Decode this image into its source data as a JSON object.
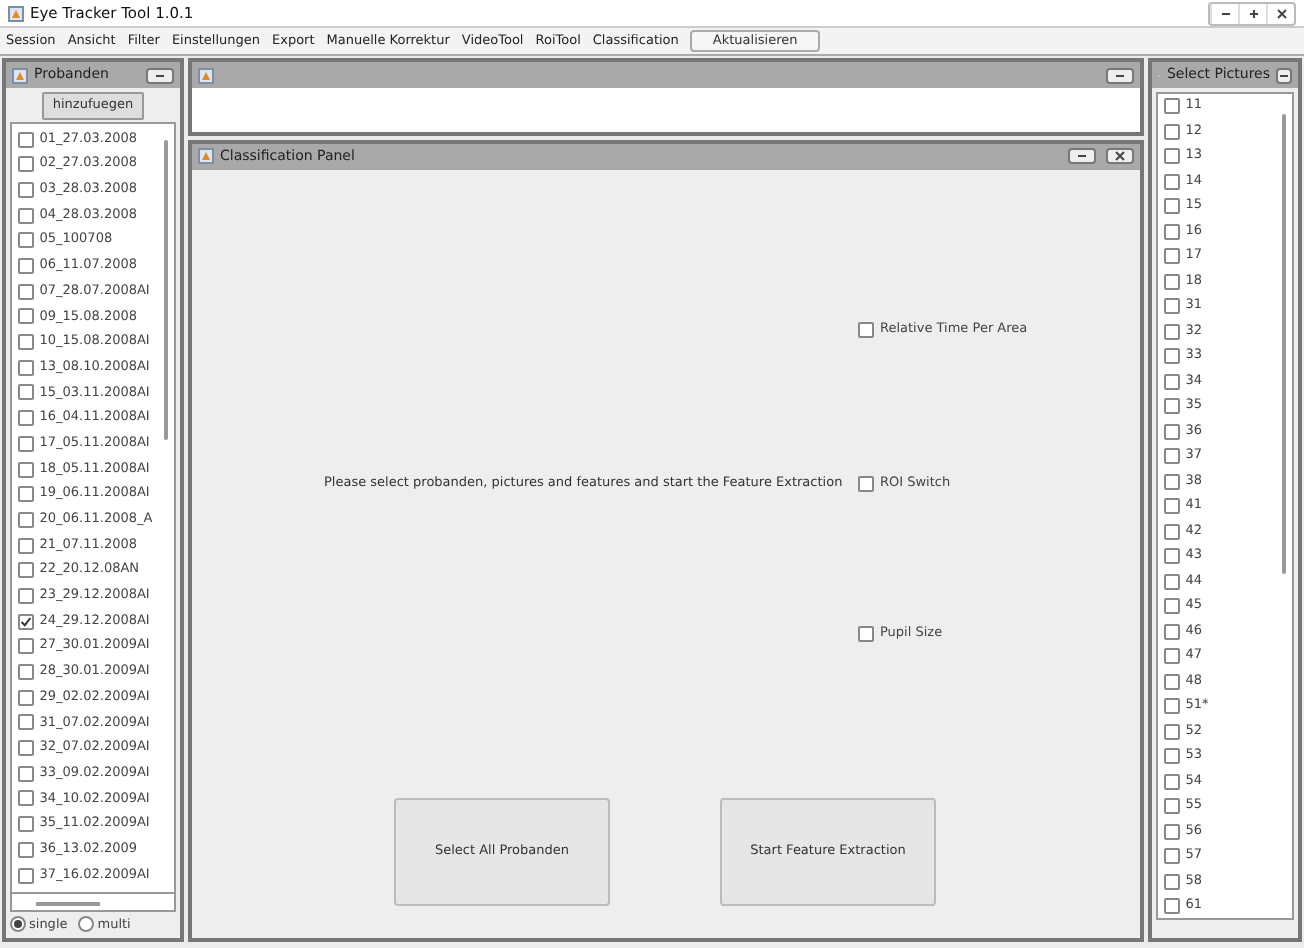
{
  "window": {
    "title": "Eye Tracker Tool 1.0.1"
  },
  "menu": [
    "Session",
    "Ansicht",
    "Filter",
    "Einstellungen",
    "Export",
    "Manuelle Korrektur",
    "VideoTool",
    "RoiTool",
    "Classification"
  ],
  "refresh_button": "Aktualisieren",
  "probanden": {
    "title": "Probanden",
    "add_button": "hinzufuegen",
    "items": [
      {
        "label": "01_27.03.2008",
        "checked": false
      },
      {
        "label": "02_27.03.2008",
        "checked": false
      },
      {
        "label": "03_28.03.2008",
        "checked": false
      },
      {
        "label": "04_28.03.2008",
        "checked": false
      },
      {
        "label": "05_100708",
        "checked": false
      },
      {
        "label": "06_11.07.2008",
        "checked": false
      },
      {
        "label": "07_28.07.2008AI",
        "checked": false
      },
      {
        "label": "09_15.08.2008",
        "checked": false
      },
      {
        "label": "10_15.08.2008AI",
        "checked": false
      },
      {
        "label": "13_08.10.2008AI",
        "checked": false
      },
      {
        "label": "15_03.11.2008AI",
        "checked": false
      },
      {
        "label": "16_04.11.2008AI",
        "checked": false
      },
      {
        "label": "17_05.11.2008AI",
        "checked": false
      },
      {
        "label": "18_05.11.2008AI",
        "checked": false
      },
      {
        "label": "19_06.11.2008AI",
        "checked": false
      },
      {
        "label": "20_06.11.2008_A",
        "checked": false
      },
      {
        "label": "21_07.11.2008",
        "checked": false
      },
      {
        "label": "22_20.12.08AN",
        "checked": false
      },
      {
        "label": "23_29.12.2008AI",
        "checked": false
      },
      {
        "label": "24_29.12.2008AI",
        "checked": true
      },
      {
        "label": "27_30.01.2009AI",
        "checked": false
      },
      {
        "label": "28_30.01.2009AI",
        "checked": false
      },
      {
        "label": "29_02.02.2009AI",
        "checked": false
      },
      {
        "label": "31_07.02.2009AI",
        "checked": false
      },
      {
        "label": "32_07.02.2009AI",
        "checked": false
      },
      {
        "label": "33_09.02.2009AI",
        "checked": false
      },
      {
        "label": "34_10.02.2009AI",
        "checked": false
      },
      {
        "label": "35_11.02.2009AI",
        "checked": false
      },
      {
        "label": "36_13.02.2009",
        "checked": false
      },
      {
        "label": "37_16.02.2009AI",
        "checked": false
      }
    ],
    "modes": [
      {
        "label": "single",
        "selected": true
      },
      {
        "label": "multi",
        "selected": false
      }
    ]
  },
  "classification_panel": {
    "title": "Classification Panel",
    "message": "Please select probanden, pictures and features and start the Feature Extraction",
    "features": [
      {
        "label": "Relative Time Per Area",
        "checked": false
      },
      {
        "label": "ROI Switch",
        "checked": false
      },
      {
        "label": "Pupil Size",
        "checked": false
      }
    ],
    "buttons": [
      "Select All Probanden",
      "Start Feature Extraction"
    ]
  },
  "pictures": {
    "title": "Select Pictures",
    "items": [
      {
        "label": "11",
        "checked": false
      },
      {
        "label": "12",
        "checked": false
      },
      {
        "label": "13",
        "checked": false
      },
      {
        "label": "14",
        "checked": false
      },
      {
        "label": "15",
        "checked": false
      },
      {
        "label": "16",
        "checked": false
      },
      {
        "label": "17",
        "checked": false
      },
      {
        "label": "18",
        "checked": false
      },
      {
        "label": "31",
        "checked": false
      },
      {
        "label": "32",
        "checked": false
      },
      {
        "label": "33",
        "checked": false
      },
      {
        "label": "34",
        "checked": false
      },
      {
        "label": "35",
        "checked": false
      },
      {
        "label": "36",
        "checked": false
      },
      {
        "label": "37",
        "checked": false
      },
      {
        "label": "38",
        "checked": false
      },
      {
        "label": "41",
        "checked": false
      },
      {
        "label": "42",
        "checked": false
      },
      {
        "label": "43",
        "checked": false
      },
      {
        "label": "44",
        "checked": false
      },
      {
        "label": "45",
        "checked": false
      },
      {
        "label": "46",
        "checked": false
      },
      {
        "label": "47",
        "checked": false
      },
      {
        "label": "48",
        "checked": false
      },
      {
        "label": "51*",
        "checked": false
      },
      {
        "label": "52",
        "checked": false
      },
      {
        "label": "53",
        "checked": false
      },
      {
        "label": "54",
        "checked": false
      },
      {
        "label": "55",
        "checked": false
      },
      {
        "label": "56",
        "checked": false
      },
      {
        "label": "57",
        "checked": false
      },
      {
        "label": "58",
        "checked": false
      },
      {
        "label": "61",
        "checked": false
      }
    ]
  }
}
